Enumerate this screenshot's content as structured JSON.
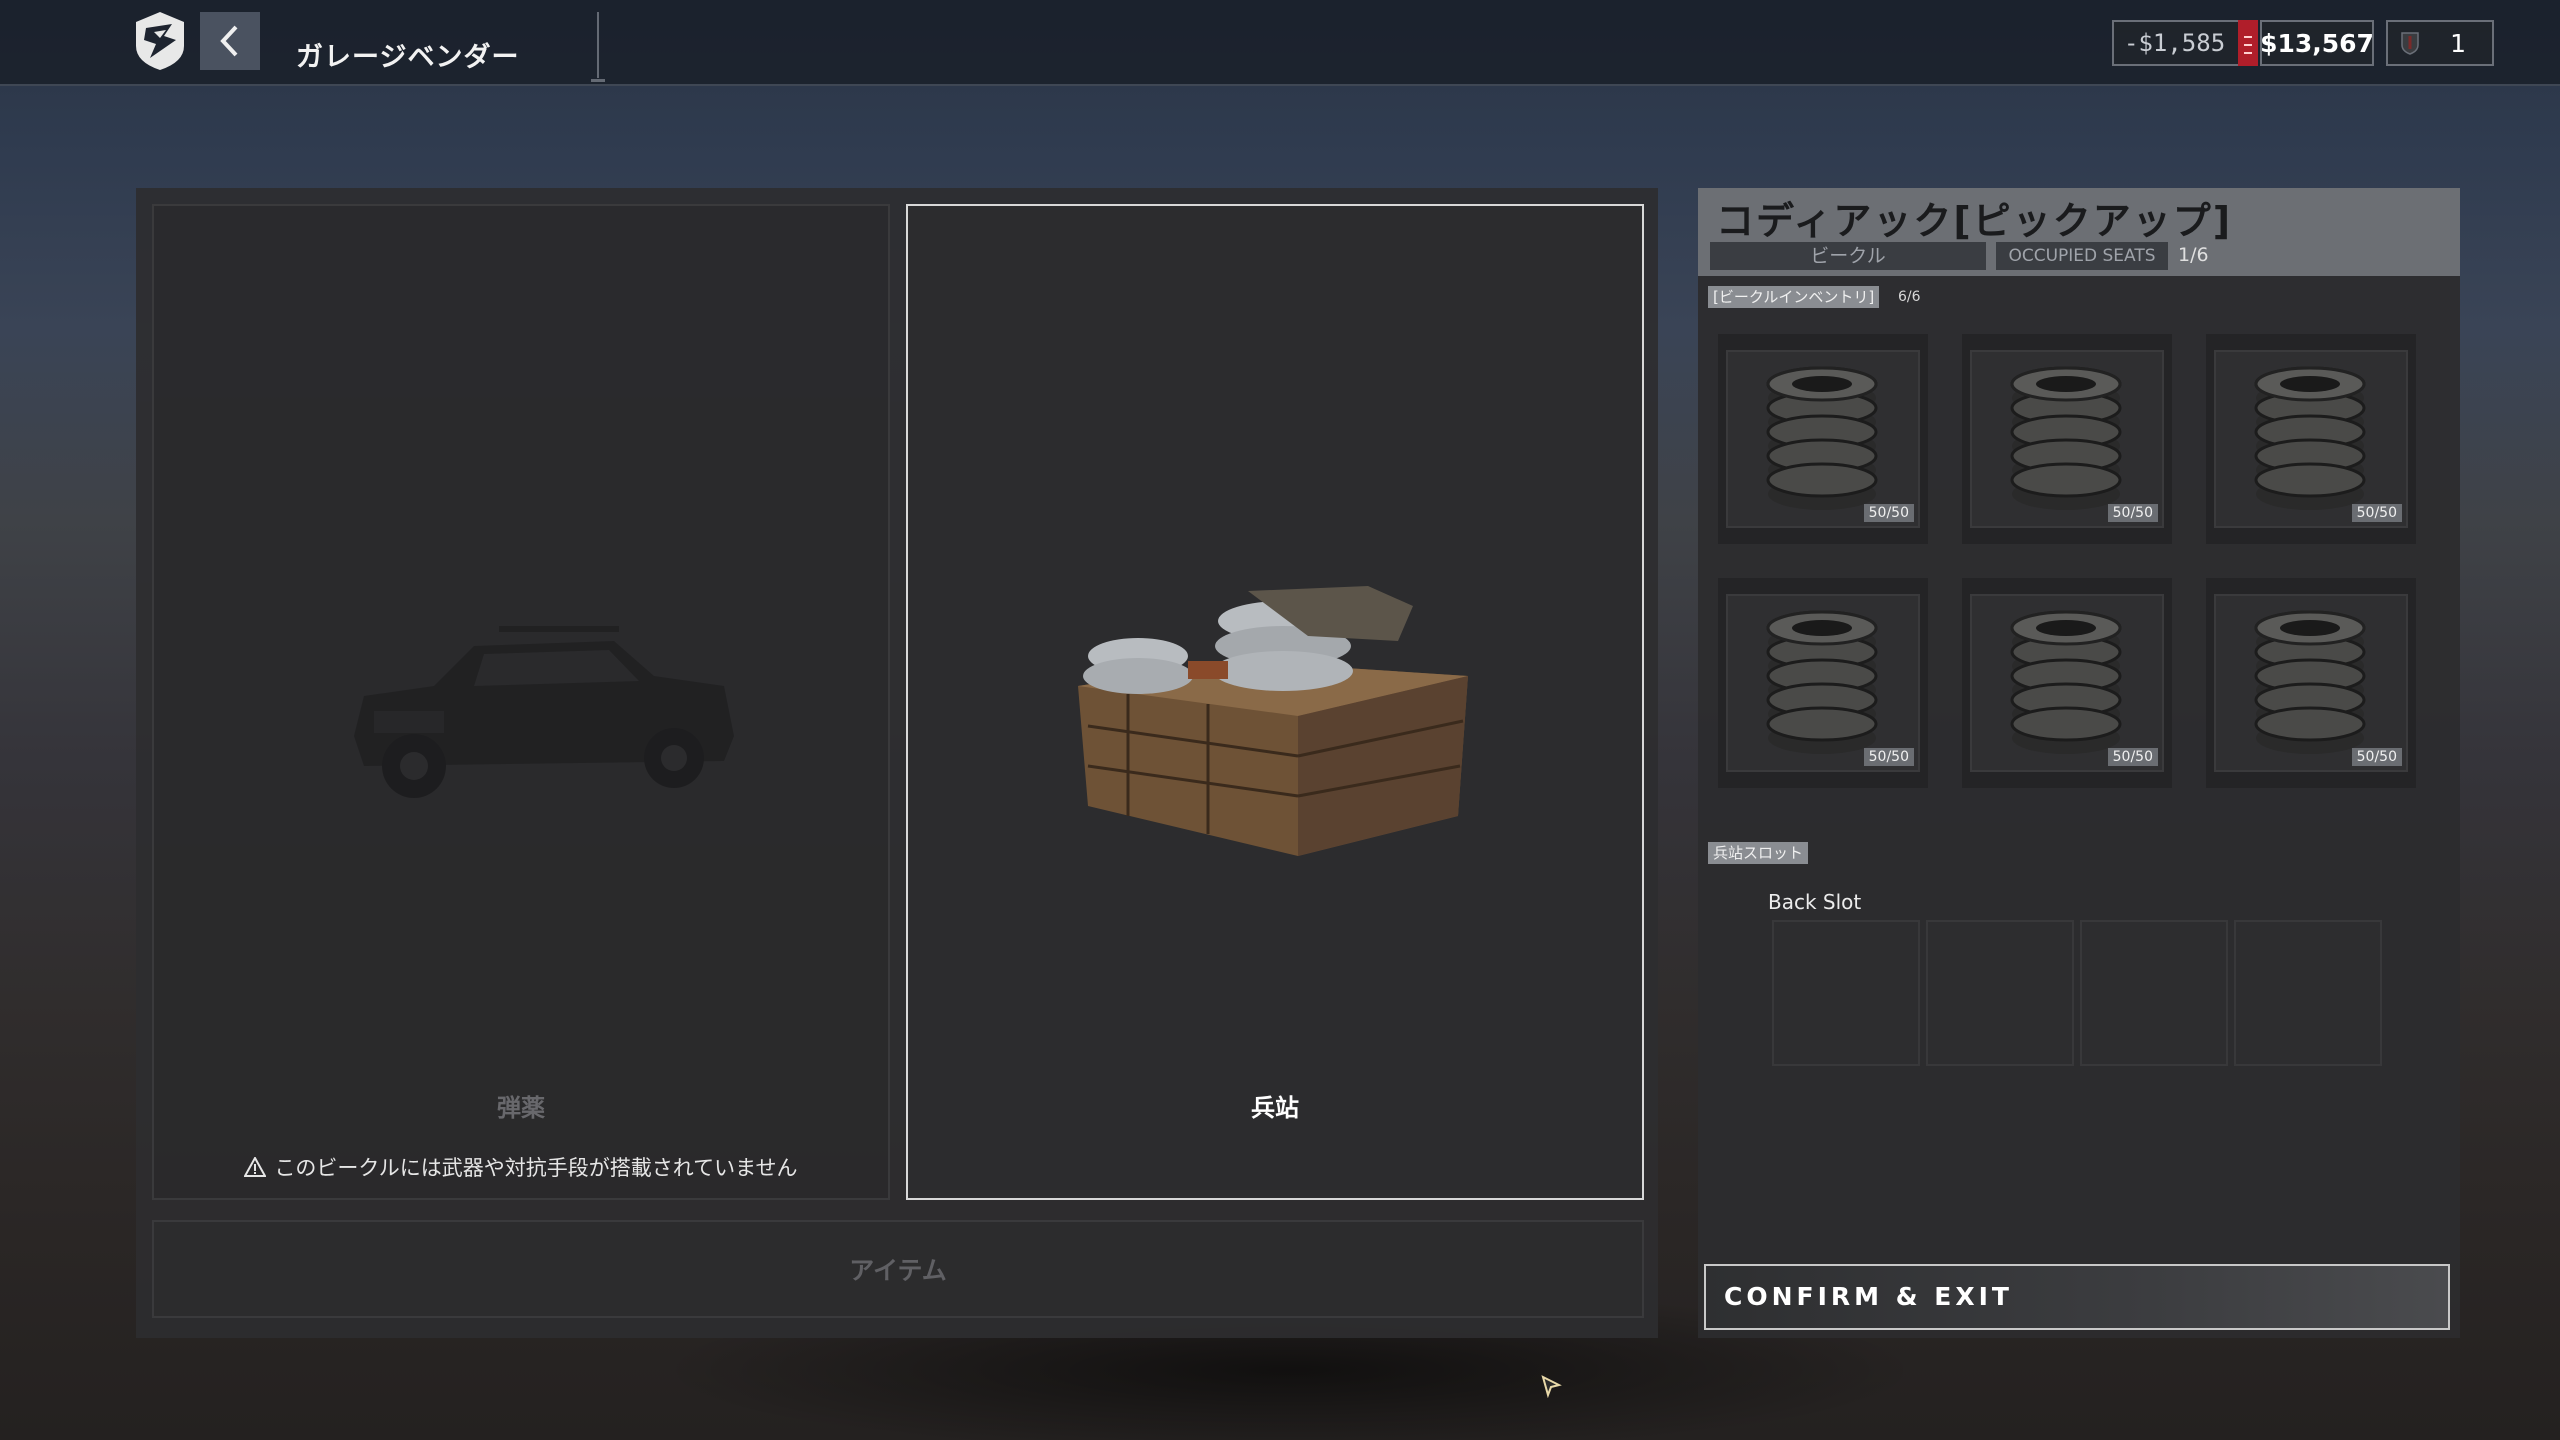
{
  "header": {
    "title": "ガレージベンダー",
    "back_icon": "chevron-left-icon",
    "logo_icon": "game-logo-icon"
  },
  "currency": {
    "negative": "-$1,585",
    "balance": "$13,567",
    "count": "1"
  },
  "cards": {
    "ammo": {
      "label": "弾薬",
      "warning": "このビークルには武器や対抗手段が搭載されていません"
    },
    "logistics": {
      "label": "兵站"
    },
    "items_label": "アイテム"
  },
  "vehicle": {
    "name": "コディアック[ピックアップ]",
    "type": "ビークル",
    "occupied_label": "OCCUPIED SEATS",
    "occupied_value": "1/6"
  },
  "inventory": {
    "tag": "[ビークルインベントリ]",
    "count": "6/6",
    "slots": [
      {
        "icon": "tire-stack-icon",
        "qty": "50/50"
      },
      {
        "icon": "tire-stack-icon",
        "qty": "50/50"
      },
      {
        "icon": "tire-stack-icon",
        "qty": "50/50"
      },
      {
        "icon": "tire-stack-icon",
        "qty": "50/50"
      },
      {
        "icon": "tire-stack-icon",
        "qty": "50/50"
      },
      {
        "icon": "tire-stack-icon",
        "qty": "50/50"
      }
    ]
  },
  "logistics_slots": {
    "tag": "兵站スロット",
    "back_slot_label": "Back Slot"
  },
  "actions": {
    "confirm": "CONFIRM & EXIT"
  },
  "colors": {
    "negative_indicator": "#b01e2a",
    "header_gray": "#6c6f74",
    "panel": "#2c2c2e"
  }
}
